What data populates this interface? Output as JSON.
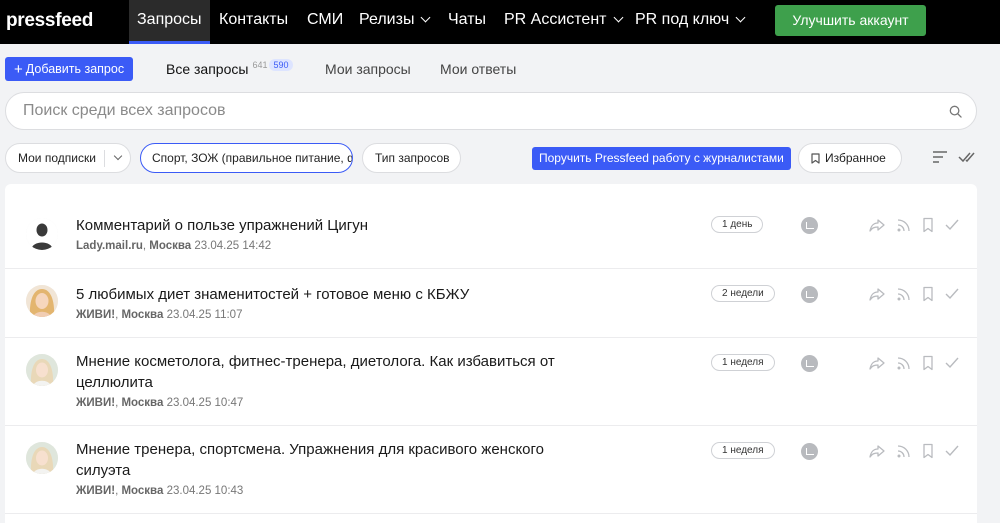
{
  "nav": {
    "logo": "pressfeed",
    "items": [
      {
        "label": "Запросы",
        "active": true,
        "dropdown": false
      },
      {
        "label": "Контакты",
        "active": false,
        "dropdown": false
      },
      {
        "label": "СМИ",
        "active": false,
        "dropdown": false
      },
      {
        "label": "Релизы",
        "active": false,
        "dropdown": true
      },
      {
        "label": "Чаты",
        "active": false,
        "dropdown": false
      },
      {
        "label": "PR Ассистент",
        "active": false,
        "dropdown": true
      },
      {
        "label": "PR под ключ",
        "active": false,
        "dropdown": true
      }
    ],
    "upgrade_label": "Улучшить аккаунт"
  },
  "tabs": {
    "add_label": "Добавить запрос",
    "all_label": "Все запросы",
    "all_count": "641",
    "all_badge": "590",
    "mine_label": "Мои запросы",
    "answers_label": "Мои ответы"
  },
  "search": {
    "placeholder": "Поиск среди всех запросов"
  },
  "filters": {
    "subscriptions_label": "Мои подписки",
    "topic_label": "Спорт, ЗОЖ (правильное питание, фитнес)",
    "type_label": "Тип запросов",
    "pr_work_label": "Поручить Pressfeed работу с журналистами",
    "favorites_label": "Избранное"
  },
  "requests": [
    {
      "title": "Комментарий о пользе упражнений Цигун",
      "outlet": "Lady.mail.ru",
      "city": "Москва",
      "date": "23.04.25 14:42",
      "age": "1 день",
      "avatar": "silhouette-icon"
    },
    {
      "title": "5 любимых диет знаменитостей + готовое меню с КБЖУ",
      "outlet": "ЖИВИ!",
      "city": "Москва",
      "date": "23.04.25 11:07",
      "age": "2 недели",
      "avatar": "photo-blonde"
    },
    {
      "title": "Мнение косметолога, фитнес-тренера, диетолога. Как избавиться от целлюлита",
      "outlet": "ЖИВИ!",
      "city": "Москва",
      "date": "23.04.25 10:47",
      "age": "1 неделя",
      "avatar": "photo-light"
    },
    {
      "title": "Мнение тренера, спортсмена. Упражнения для красивого женского силуэта",
      "outlet": "ЖИВИ!",
      "city": "Москва",
      "date": "23.04.25 10:43",
      "age": "1 неделя",
      "avatar": "photo-light"
    }
  ],
  "colors": {
    "accent": "#3b5bf6",
    "upgrade": "#3ea04c",
    "topbar": "#000000"
  }
}
